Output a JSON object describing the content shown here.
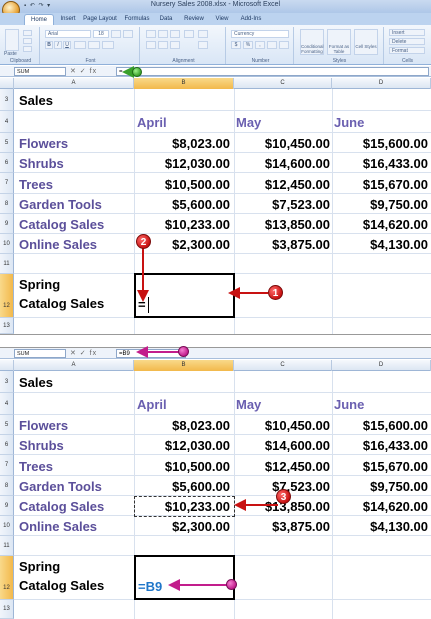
{
  "window": {
    "title": "Nursery Sales 2008.xlsx - Microsoft Excel",
    "qat": "▪ ↶ ↷ ▾"
  },
  "ribbon": {
    "tabs": [
      "Home",
      "Insert",
      "Page Layout",
      "Formulas",
      "Data",
      "Review",
      "View",
      "Add-Ins"
    ],
    "active_tab": "Home",
    "groups": [
      "Clipboard",
      "Font",
      "Alignment",
      "Number",
      "Styles",
      "Cells"
    ],
    "font_name": "Arial",
    "font_size": "18",
    "number_format": "Currency",
    "paste_label": "Paste",
    "styles_buttons": [
      "Conditional Formatting",
      "Format as Table",
      "Cell Styles"
    ],
    "cells_buttons": [
      "Insert",
      "Delete",
      "Format"
    ]
  },
  "columns": [
    "A",
    "B",
    "C",
    "D"
  ],
  "top": {
    "name_box": "SUM",
    "formula_icons": "✕ ✓ fx",
    "formula_value": "=",
    "active_cell_value": "="
  },
  "bottom": {
    "name_box": "SUM",
    "formula_icons": "✕ ✓ fx",
    "formula_value": "=B9",
    "active_cell_value": "=B9"
  },
  "sheet": {
    "title": "Sales",
    "months": [
      "April",
      "May",
      "June"
    ],
    "rows": [
      {
        "row": "5",
        "category": "Flowers",
        "values": [
          "$8,023.00",
          "$10,450.00",
          "$15,600.00"
        ]
      },
      {
        "row": "6",
        "category": "Shrubs",
        "values": [
          "$12,030.00",
          "$14,600.00",
          "$16,433.00"
        ]
      },
      {
        "row": "7",
        "category": "Trees",
        "values": [
          "$10,500.00",
          "$12,450.00",
          "$15,670.00"
        ]
      },
      {
        "row": "8",
        "category": "Garden Tools",
        "values": [
          "$5,600.00",
          "$7,523.00",
          "$9,750.00"
        ]
      },
      {
        "row": "9",
        "category": "Catalog Sales",
        "values": [
          "$10,233.00",
          "$13,850.00",
          "$14,620.00"
        ]
      },
      {
        "row": "10",
        "category": "Online Sales",
        "values": [
          "$2,300.00",
          "$3,875.00",
          "$4,130.00"
        ]
      }
    ],
    "spring_label_1": "Spring",
    "spring_label_2": "Catalog Sales",
    "row_numbers_top": [
      "3",
      "4",
      "5",
      "6",
      "7",
      "8",
      "9",
      "10",
      "11",
      "12",
      "13"
    ],
    "row_numbers_bottom": [
      "3",
      "4",
      "5",
      "6",
      "7",
      "8",
      "9",
      "10",
      "11",
      "12",
      "13"
    ]
  },
  "callouts": {
    "one": "1",
    "two": "2",
    "three": "3"
  },
  "colors": {
    "category_text": "#5b4f9a",
    "month_text": "#6a5fb0",
    "reference_blue": "#1f76c9",
    "callout_red": "#c81212",
    "callout_magenta": "#c21d8c",
    "callout_green": "#3aa02a"
  }
}
